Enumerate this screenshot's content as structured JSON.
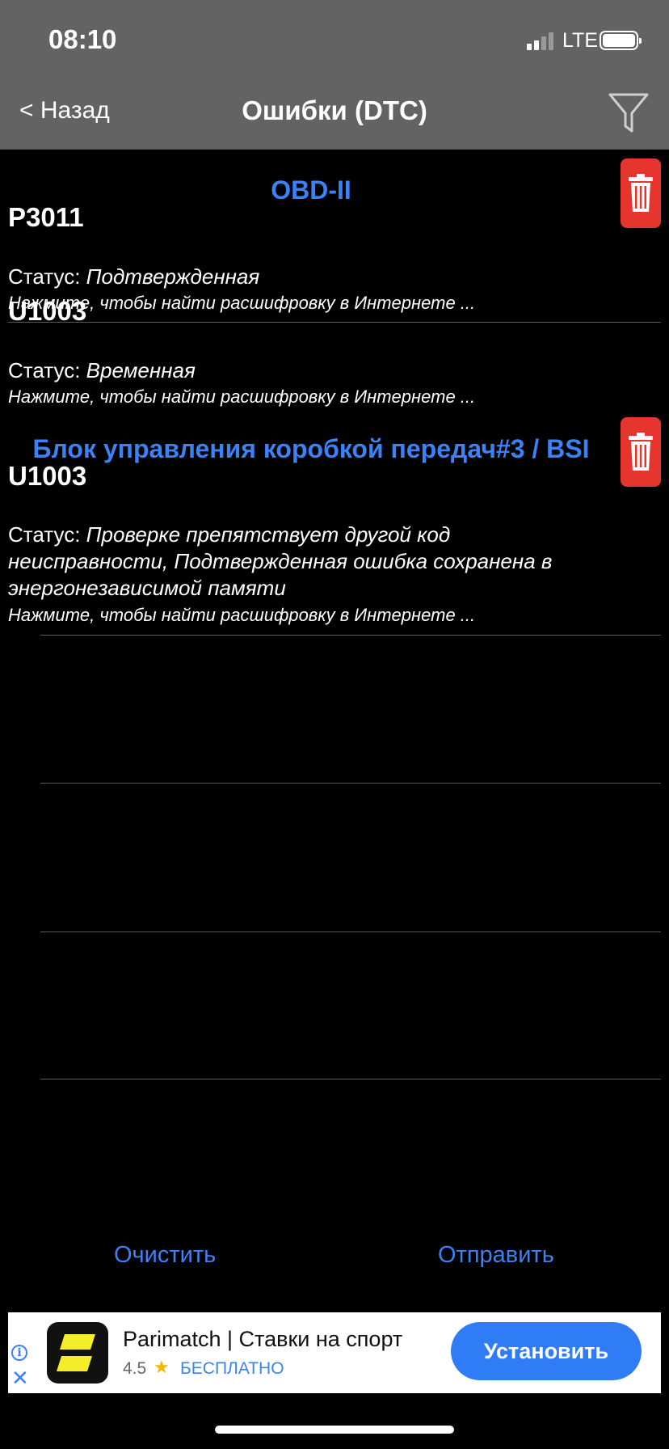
{
  "status_bar": {
    "time": "08:10",
    "network": "LTE"
  },
  "nav": {
    "back_label": "< Назад",
    "title": "Ошибки (DTC)",
    "filter_icon": "filter-icon"
  },
  "sections": [
    {
      "title": "OBD-II",
      "delete_icon": "trash-icon",
      "items": [
        {
          "code": "P3011",
          "status_label": "Статус: ",
          "status_value": "Подтвержденная",
          "hint": "Нажмите, чтобы найти расшифровку в Интернете ..."
        },
        {
          "code": "U1003",
          "status_label": "Статус: ",
          "status_value": "Временная",
          "hint": "Нажмите, чтобы найти расшифровку в Интернете ..."
        }
      ]
    },
    {
      "title": "Блок управления коробкой передач#3 / BSI",
      "delete_icon": "trash-icon",
      "items": [
        {
          "code": "U1003",
          "status_label": "Статус: ",
          "status_value": "Проверке препятствует другой код неисправности, Подтвержденная ошибка сохранена в энергонезависимой памяти",
          "hint": "Нажмите, чтобы найти расшифровку в Интернете ..."
        }
      ]
    }
  ],
  "footer": {
    "clear_label": "Очистить",
    "send_label": "Отправить"
  },
  "ad": {
    "title": "Parimatch | Ставки на спорт",
    "rating": "4.5",
    "price": "БЕСПЛАТНО",
    "install_label": "Установить",
    "info_glyph": "i",
    "close_glyph": "✕",
    "star_glyph": "★"
  },
  "colors": {
    "accent": "#3b82f6",
    "delete": "#e5352c",
    "bar": "#636363",
    "background": "#000000"
  }
}
